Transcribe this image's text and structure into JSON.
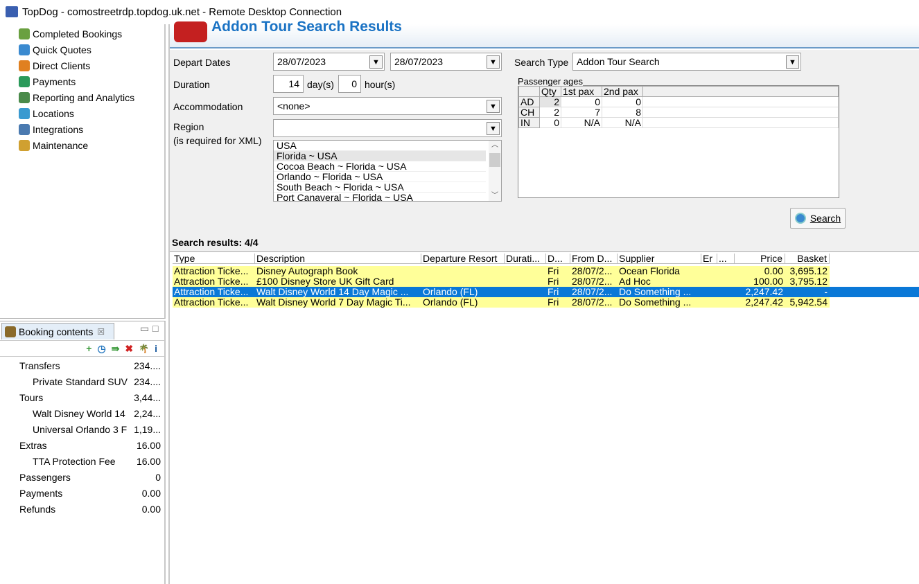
{
  "window": {
    "title": "TopDog - comostreetrdp.topdog.uk.net - Remote Desktop Connection"
  },
  "nav": {
    "items": [
      {
        "label": "Completed Bookings",
        "icon": "palm-icon"
      },
      {
        "label": "Quick Quotes",
        "icon": "clock-icon"
      },
      {
        "label": "Direct Clients",
        "icon": "person-icon"
      },
      {
        "label": "Payments",
        "icon": "money-icon"
      },
      {
        "label": "Reporting and Analytics",
        "icon": "report-icon"
      },
      {
        "label": "Locations",
        "icon": "globe-icon"
      },
      {
        "label": "Integrations",
        "icon": "integration-icon"
      },
      {
        "label": "Maintenance",
        "icon": "maintenance-icon"
      }
    ]
  },
  "booking": {
    "tab": "Booking contents",
    "close": "☒",
    "toolbar": [
      "+",
      "◷",
      "⇛",
      "✖",
      "🌴",
      "i"
    ],
    "rows": [
      {
        "label": "Transfers",
        "value": "234....",
        "indent": 0
      },
      {
        "label": "Private Standard SUV",
        "value": "234....",
        "indent": 1
      },
      {
        "label": "Tours",
        "value": "3,44...",
        "indent": 0
      },
      {
        "label": "Walt Disney World 14",
        "value": "2,24...",
        "indent": 1
      },
      {
        "label": "Universal Orlando 3 F",
        "value": "1,19...",
        "indent": 1
      },
      {
        "label": "Extras",
        "value": "16.00",
        "indent": 0
      },
      {
        "label": "TTA Protection Fee",
        "value": "16.00",
        "indent": 1
      },
      {
        "label": "Passengers",
        "value": "0",
        "indent": 0
      },
      {
        "label": "Payments",
        "value": "0.00",
        "indent": 0
      },
      {
        "label": "Refunds",
        "value": "0.00",
        "indent": 0
      }
    ]
  },
  "page": {
    "title": "Addon Tour Search Results"
  },
  "form": {
    "depart_label": "Depart Dates",
    "depart_from": "28/07/2023",
    "depart_to": "28/07/2023",
    "duration_label": "Duration",
    "days": "14",
    "days_unit": "day(s)",
    "hours": "0",
    "hours_unit": "hour(s)",
    "accom_label": "Accommodation",
    "accom_value": "<none>",
    "region_label": "Region",
    "region_note": "(is required for XML)",
    "region_value": "",
    "region_options": [
      "USA",
      "Florida ~ USA",
      "Cocoa Beach ~ Florida ~ USA",
      "Orlando ~ Florida ~ USA",
      "South Beach ~ Florida ~ USA",
      "Port Canaveral ~ Florida ~ USA"
    ],
    "search_type_label": "Search Type",
    "search_type_value": "Addon Tour Search",
    "pax_title": "Passenger ages",
    "pax_headers": [
      "",
      "Qty",
      "1st pax",
      "2nd pax"
    ],
    "pax_rows": [
      [
        "AD",
        "2",
        "0",
        "0"
      ],
      [
        "CH",
        "2",
        "7",
        "8"
      ],
      [
        "IN",
        "0",
        "N/A",
        "N/A"
      ]
    ],
    "search_button": "Search"
  },
  "results": {
    "title": "Search results: 4/4",
    "headers": [
      "Type",
      "Description",
      "Departure Resort",
      "Durati...",
      "D...",
      "From D...",
      "Supplier",
      "Er",
      "...",
      "Price",
      "Basket"
    ],
    "rows": [
      [
        "Attraction Ticke...",
        "Disney Autograph Book",
        "",
        "",
        "Fri",
        "28/07/2...",
        "Ocean Florida",
        "",
        "",
        "0.00",
        "3,695.12"
      ],
      [
        "Attraction Ticke...",
        "£100 Disney Store UK Gift Card",
        "",
        "",
        "Fri",
        "28/07/2...",
        "Ad Hoc",
        "",
        "",
        "100.00",
        "3,795.12"
      ],
      [
        "Attraction Ticke...",
        "Walt Disney World 14 Day Magic ...",
        "Orlando (FL)",
        "",
        "Fri",
        "28/07/2...",
        "Do Something ...",
        "",
        "",
        "2,247.42",
        "-"
      ],
      [
        "Attraction Ticke...",
        "Walt Disney World 7 Day Magic Ti...",
        "Orlando (FL)",
        "",
        "Fri",
        "28/07/2...",
        "Do Something ...",
        "",
        "",
        "2,247.42",
        "5,942.54"
      ]
    ],
    "selected_row": 2
  }
}
